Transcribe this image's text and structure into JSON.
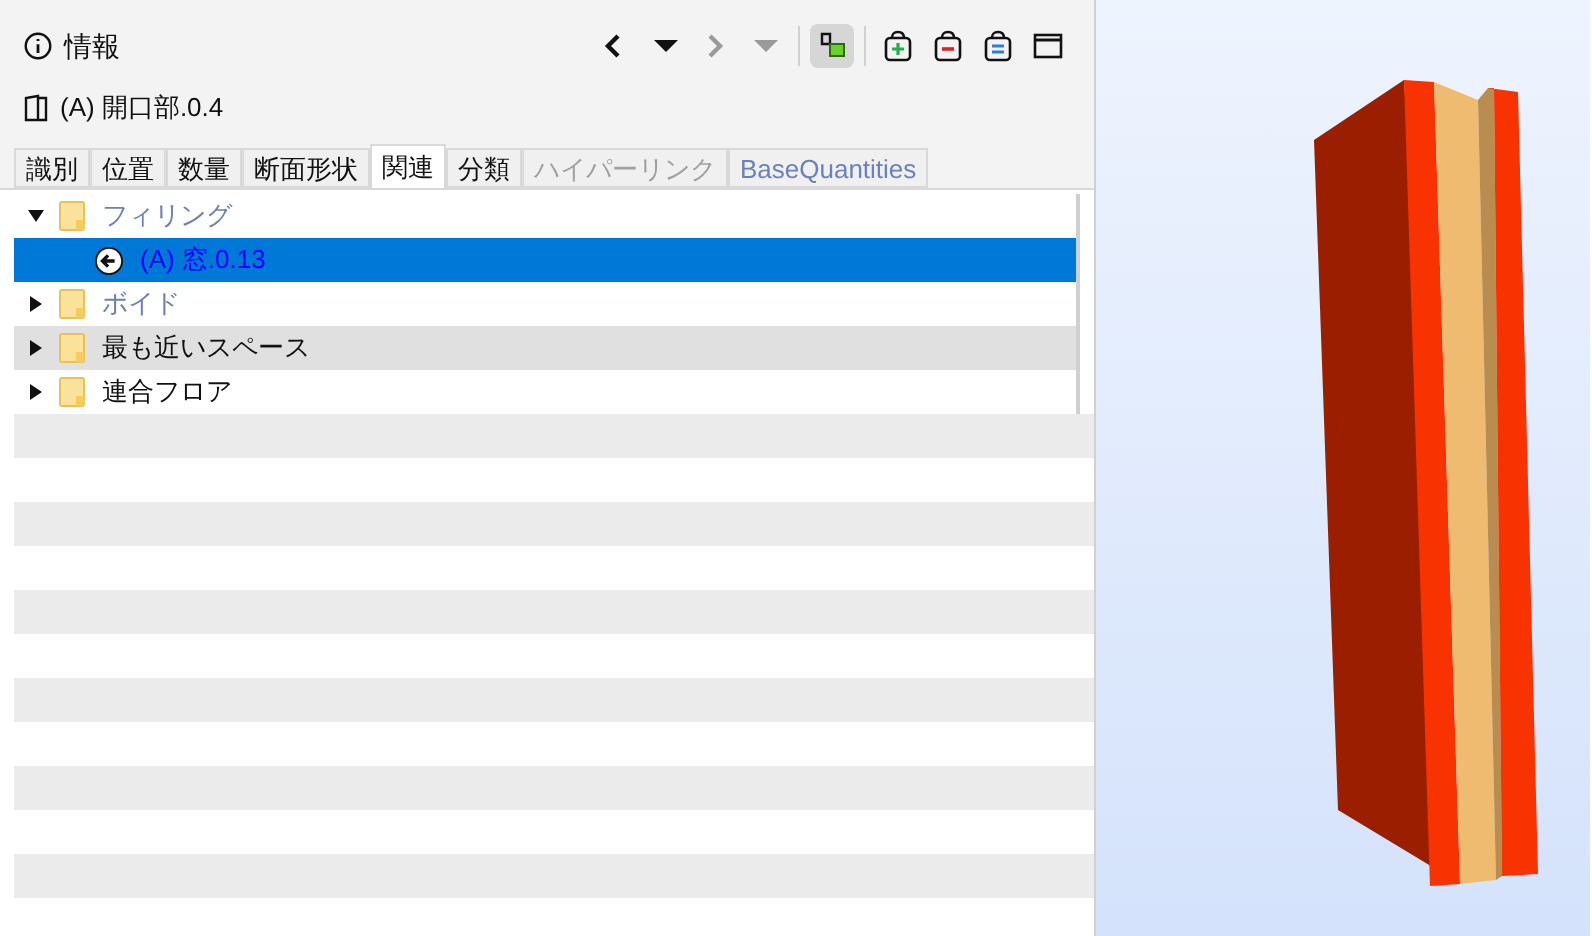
{
  "panel": {
    "title": "情報",
    "element": "(A) 開口部.0.4"
  },
  "toolbar": [
    {
      "kind": "back",
      "disabled": false,
      "on": false
    },
    {
      "kind": "back-menu",
      "disabled": false,
      "on": false
    },
    {
      "kind": "forward",
      "disabled": true,
      "on": false
    },
    {
      "kind": "forward-menu",
      "disabled": true,
      "on": false
    },
    {
      "kind": "isolate",
      "disabled": false,
      "on": true
    },
    {
      "kind": "add",
      "disabled": false,
      "on": false
    },
    {
      "kind": "remove",
      "disabled": false,
      "on": false
    },
    {
      "kind": "equal",
      "disabled": false,
      "on": false
    },
    {
      "kind": "window",
      "disabled": false,
      "on": false
    }
  ],
  "tabs": [
    {
      "label": "識別",
      "selected": false,
      "kind": "normal"
    },
    {
      "label": "位置",
      "selected": false,
      "kind": "normal"
    },
    {
      "label": "数量",
      "selected": false,
      "kind": "normal"
    },
    {
      "label": "断面形状",
      "selected": false,
      "kind": "normal"
    },
    {
      "label": "関連",
      "selected": true,
      "kind": "normal"
    },
    {
      "label": "分類",
      "selected": false,
      "kind": "normal"
    },
    {
      "label": "ハイパーリンク",
      "selected": false,
      "kind": "disabled"
    },
    {
      "label": "BaseQuantities",
      "selected": false,
      "kind": "link"
    }
  ],
  "tree": [
    {
      "label": "フィリング",
      "expanded": true,
      "disabled": true,
      "selected": false,
      "children": [
        {
          "label": "(A) 窓.0.13",
          "selected": true
        }
      ]
    },
    {
      "label": "ボイド",
      "expanded": false,
      "disabled": true,
      "selected": false
    },
    {
      "label": "最も近いスペース",
      "expanded": false,
      "disabled": false,
      "selected": false
    },
    {
      "label": "連合フロア",
      "expanded": false,
      "disabled": false,
      "selected": false
    }
  ]
}
